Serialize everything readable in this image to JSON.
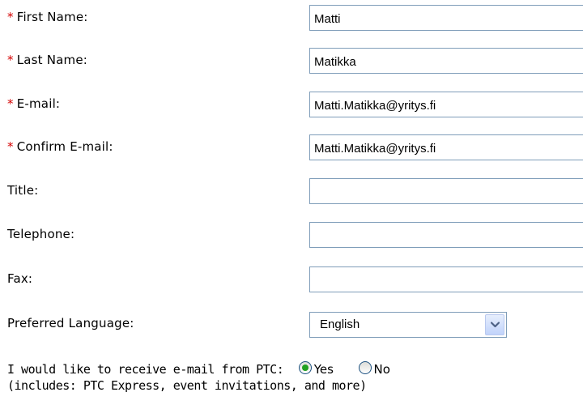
{
  "form": {
    "fields": [
      {
        "label": "First Name:",
        "required": true,
        "value": "Matti"
      },
      {
        "label": "Last Name:",
        "required": true,
        "value": "Matikka"
      },
      {
        "label": "E-mail:",
        "required": true,
        "value": "Matti.Matikka@yritys.fi"
      },
      {
        "label": "Confirm E-mail:",
        "required": true,
        "value": "Matti.Matikka@yritys.fi"
      },
      {
        "label": "Title:",
        "required": false,
        "value": ""
      },
      {
        "label": "Telephone:",
        "required": false,
        "value": ""
      },
      {
        "label": "Fax:",
        "required": false,
        "value": ""
      }
    ],
    "required_marker": "*",
    "language": {
      "label": "Preferred Language:",
      "selected": "English",
      "dropdown_icon": "chevron-down-icon"
    },
    "optin": {
      "question": "I would like to receive e-mail from PTC:",
      "options": [
        {
          "label": "Yes",
          "checked": true
        },
        {
          "label": "No",
          "checked": false
        }
      ],
      "note": "(includes: PTC Express, event invitations, and more)"
    }
  },
  "colors": {
    "required_marker": "#d40000",
    "input_border": "#7f9db9",
    "radio_dot": "#21a121",
    "dropdown_button": "#c1d3fb"
  }
}
